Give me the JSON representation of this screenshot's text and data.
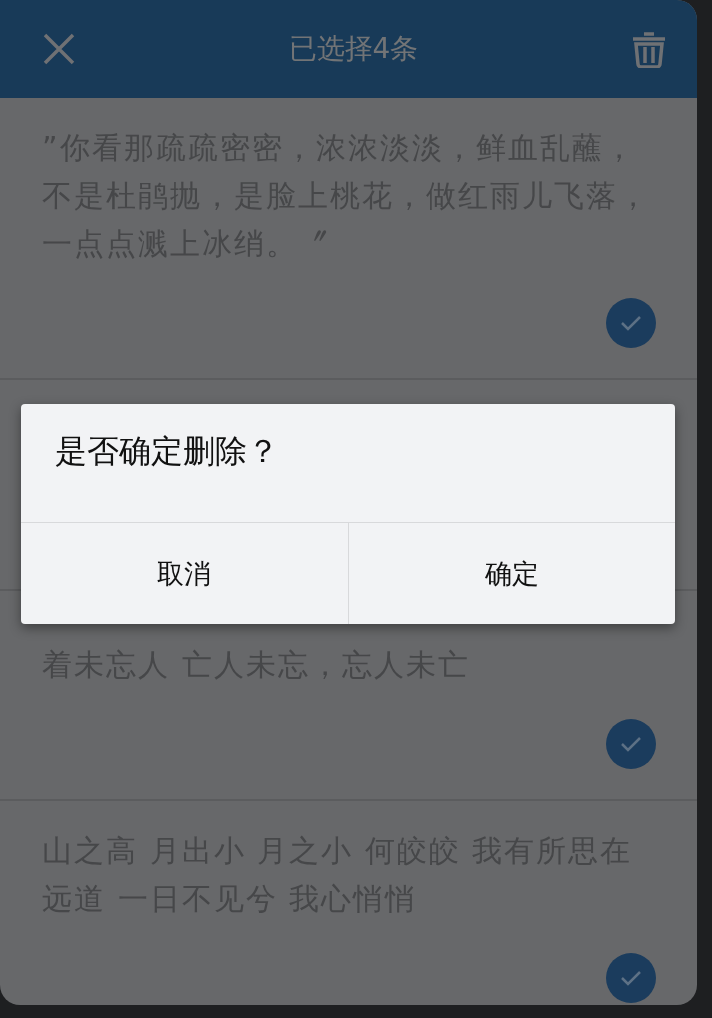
{
  "toolbar": {
    "title": "已选择4条"
  },
  "notes": [
    {
      "text": "”你看那疏疏密密，浓浓淡淡，鲜血乱蘸，不是杜鹃抛，是脸上桃花，做红雨儿飞落，一点点溅上冰绡。〞",
      "selected": true
    },
    {
      "text": "着未忘人 亡人未忘，忘人未亡",
      "selected": true
    },
    {
      "text": "山之高 月出小 月之小 何皎皎 我有所思在远道 一日不见兮  我心悄悄",
      "selected": true
    }
  ],
  "dialog": {
    "message": "是否确定删除？",
    "buttons": [
      "取消",
      "确定"
    ]
  }
}
